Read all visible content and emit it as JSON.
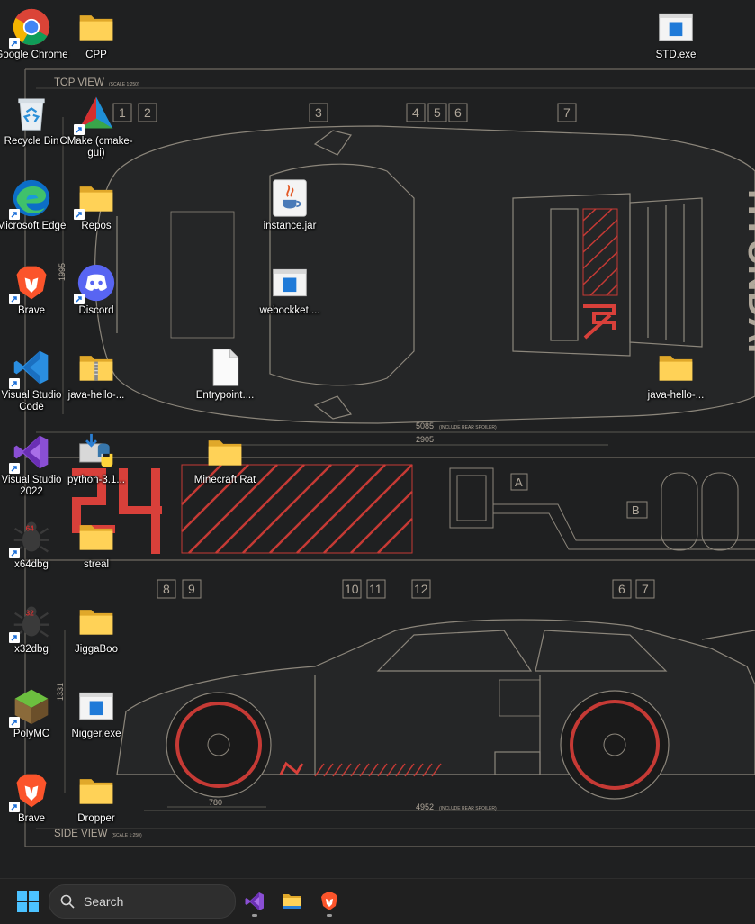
{
  "wallpaper": {
    "top_view_label": "TOP VIEW",
    "top_view_scale": "(SCALE 1:250)",
    "side_view_label": "SIDE VIEW",
    "side_view_scale": "(SCALE 1:250)",
    "dim_1995": "1995",
    "dim_5085": "5085",
    "dim_5085_note": "(INCLUDE REAR SPOILER)",
    "dim_2905": "2905",
    "dim_1331": "1331",
    "dim_780": "780",
    "dim_4952": "4952",
    "dim_4952_note": "(INCLUDE REAR SPOILER)",
    "top_callouts": [
      "1",
      "2",
      "3",
      "4",
      "5",
      "6",
      "7"
    ],
    "side_callouts": [
      "8",
      "9",
      "10",
      "11",
      "12",
      "6",
      "7"
    ],
    "diagram_labels": [
      "A",
      "B"
    ],
    "brand_text": "HYUNDAI"
  },
  "desktop": {
    "icons": [
      {
        "label": "Google Chrome",
        "icon": "chrome-icon"
      },
      {
        "label": "CPP",
        "icon": "folder-icon"
      },
      {
        "label": "STD.exe",
        "icon": "app-window-icon"
      },
      {
        "label": "Recycle Bin",
        "icon": "recycle-bin-icon"
      },
      {
        "label": "CMake (cmake-gui)",
        "icon": "cmake-icon"
      },
      {
        "label": "Microsoft Edge",
        "icon": "edge-icon"
      },
      {
        "label": "Repos",
        "icon": "folder-icon"
      },
      {
        "label": "instance.jar",
        "icon": "java-icon"
      },
      {
        "label": "Brave",
        "icon": "brave-icon"
      },
      {
        "label": "Discord",
        "icon": "discord-icon"
      },
      {
        "label": "webockket....",
        "icon": "app-window-icon"
      },
      {
        "label": "Visual Studio Code",
        "icon": "vscode-icon"
      },
      {
        "label": "java-hello-...",
        "icon": "zip-folder-icon"
      },
      {
        "label": "Entrypoint....",
        "icon": "file-icon"
      },
      {
        "label": "java-hello-...",
        "icon": "folder-icon"
      },
      {
        "label": "Visual Studio 2022",
        "icon": "visual-studio-icon"
      },
      {
        "label": "python-3.1...",
        "icon": "python-installer-icon"
      },
      {
        "label": "Minecraft Rat",
        "icon": "folder-icon"
      },
      {
        "label": "x64dbg",
        "icon": "x64dbg-icon"
      },
      {
        "label": "streal",
        "icon": "folder-icon"
      },
      {
        "label": "x32dbg",
        "icon": "x32dbg-icon"
      },
      {
        "label": "JiggaBoo",
        "icon": "folder-icon"
      },
      {
        "label": "PolyMC",
        "icon": "polymc-icon"
      },
      {
        "label": "Nigger.exe",
        "icon": "app-window-icon"
      },
      {
        "label": "Brave",
        "icon": "brave-icon"
      },
      {
        "label": "Dropper",
        "icon": "folder-icon"
      }
    ]
  },
  "taskbar": {
    "search_placeholder": "Search",
    "apps": [
      "visual-studio-icon",
      "file-explorer-icon",
      "brave-icon"
    ]
  }
}
